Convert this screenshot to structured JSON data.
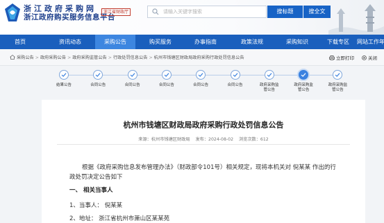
{
  "header": {
    "site_name": "浙江政府采购网",
    "site_sub": "浙江政府购买服务信息平台",
    "org_tag": "浙江省财政厅",
    "search_placeholder": "请输入关键字搜索",
    "btn_title_search": "搜标题",
    "btn_full_search": "搜全文"
  },
  "nav": {
    "items": [
      {
        "label": "首页",
        "active": false
      },
      {
        "label": "资讯动态",
        "active": false
      },
      {
        "label": "采购公告",
        "active": true
      },
      {
        "label": "购买服务",
        "active": false
      },
      {
        "label": "办事指南",
        "active": false
      },
      {
        "label": "政策法规",
        "active": false
      },
      {
        "label": "采购知识",
        "active": false
      },
      {
        "label": "下载专区",
        "active": false
      },
      {
        "label": "网站工作年",
        "active": false
      }
    ]
  },
  "breadcrumb": {
    "items": [
      "采购公告",
      "政府采购公告",
      "政府采购监管公告",
      "行政处罚信息公告",
      "杭州市钱塘区财政局政府采购行政处罚信息公告"
    ],
    "print_label": "立即打印",
    "close_label": "关闭"
  },
  "steps": [
    {
      "label": "结果公告",
      "active": false
    },
    {
      "label": "合同公告",
      "active": false
    },
    {
      "label": "合同公告",
      "active": false
    },
    {
      "label": "合同公告",
      "active": false
    },
    {
      "label": "合同公告",
      "active": false
    },
    {
      "label": "合同公告",
      "active": false
    },
    {
      "label": "政府采购监\n管公告",
      "active": false
    },
    {
      "label": "政府采购监\n管公告",
      "active": true
    },
    {
      "label": "政府采购监\n管公告",
      "active": false
    }
  ],
  "article": {
    "title": "杭州市钱塘区财政局政府采购行政处罚信息公告",
    "source": "来源：杭州市钱塘区财政局",
    "date": "发布：2024-08-02",
    "views": "浏览次数：612",
    "para1": "根据《政府采购信息发布管理办法》（财政部令101号）相关规定，现将本机关对 倪某某 作出的行政处罚决定公告如下",
    "heading1": "一、 相关当事人",
    "item1": "1、当事人：  倪某某",
    "item2": "2、地址：  浙江省杭州市萧山区某某苑"
  },
  "colors": {
    "nav_bg": "#1a5fbd",
    "nav_active": "#3d86e0",
    "brand_text": "#1d3f8c",
    "button_bg": "#1763c6",
    "step_active": "#3b82e0"
  }
}
